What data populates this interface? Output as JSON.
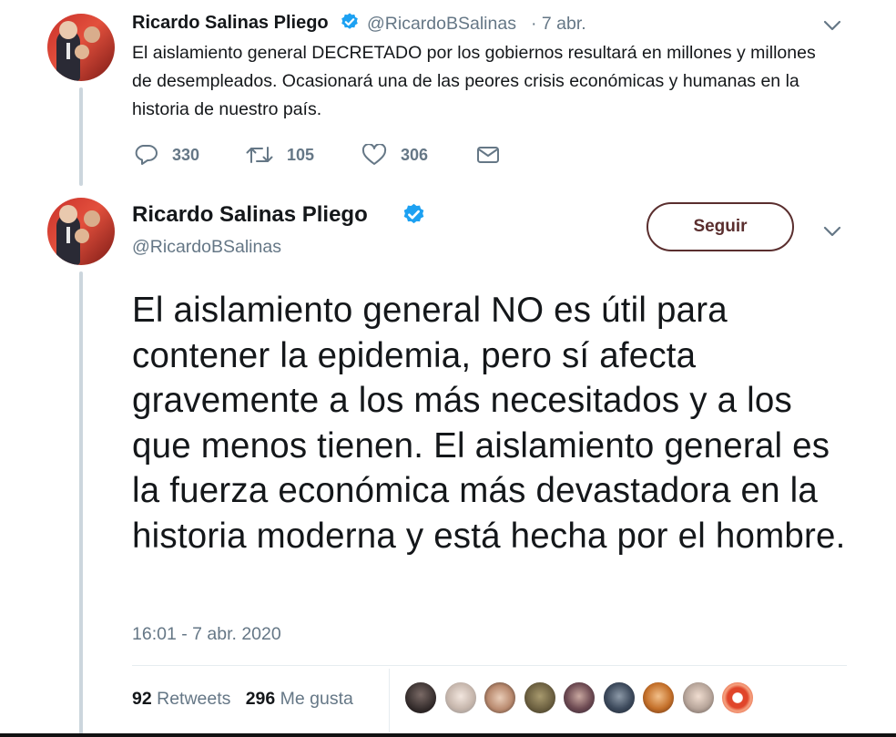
{
  "tweet1": {
    "name": "Ricardo Salinas Pliego",
    "handle": "@RicardoBSalinas",
    "date": "· 7 abr.",
    "text": "El aislamiento general DECRETADO por los gobiernos resultará en millones y millones de desempleados. Ocasionará una de las peores crisis económicas y humanas en la historia de nuestro país.",
    "replies": "330",
    "retweets": "105",
    "likes": "306"
  },
  "tweet2": {
    "name": "Ricardo Salinas Pliego",
    "handle": "@RicardoBSalinas",
    "follow_label": "Seguir",
    "text": "El aislamiento general NO es útil para contener la epidemia, pero sí afecta gravemente a los más necesitados y a los que menos tienen. El aislamiento general es la fuerza económica más devastadora en la historia moderna y está hecha por el hombre.",
    "timestamp": "16:01 - 7 abr. 2020",
    "retweet_count": "92",
    "retweet_label": "Retweets",
    "like_count": "296",
    "like_label": "Me gusta"
  },
  "icons": {
    "verified": "verified-badge-icon",
    "caret": "chevron-down-icon",
    "reply": "reply-icon",
    "retweet": "retweet-icon",
    "like": "heart-icon",
    "dm": "envelope-icon"
  },
  "colors": {
    "accent": "#1da1f2",
    "secondary_text": "#657786",
    "follow_border": "#5a2e2e",
    "thread_line": "#ccd6dd"
  }
}
